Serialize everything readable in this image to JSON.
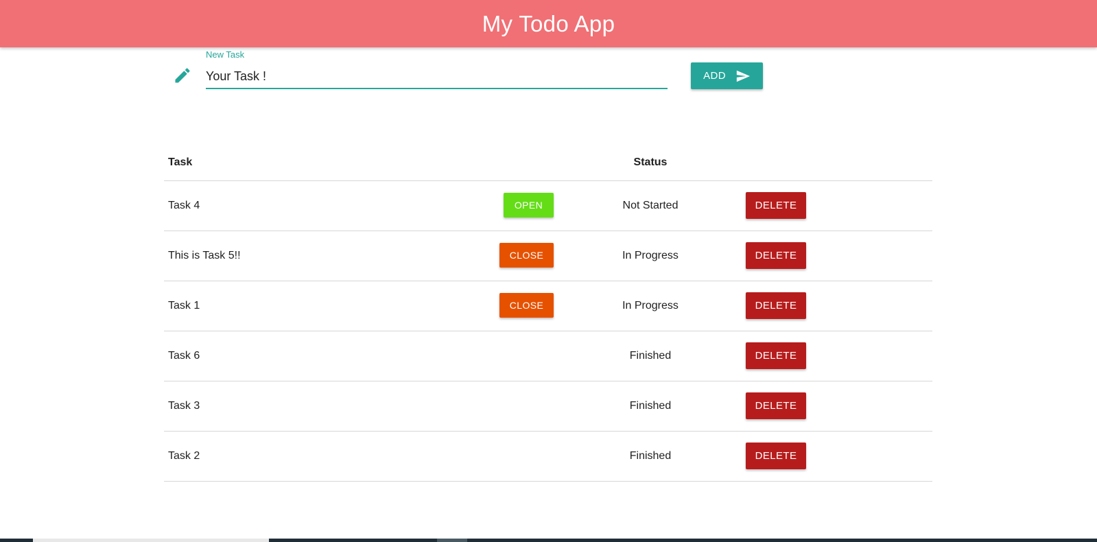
{
  "app": {
    "title": "My Todo App",
    "accent": "#26a69a",
    "bar_color": "#f07075"
  },
  "new_task": {
    "label": "New Task",
    "value": "Your Task !",
    "icon": "pencil-icon",
    "add_label": "ADD",
    "add_icon": "send-icon"
  },
  "table": {
    "headers": {
      "task": "Task",
      "status": "Status"
    },
    "rows": [
      {
        "task": "Task 4",
        "action": "OPEN",
        "status": "Not Started",
        "delete": "DELETE"
      },
      {
        "task": "This is Task 5!!",
        "action": "CLOSE",
        "status": "In Progress",
        "delete": "DELETE"
      },
      {
        "task": "Task 1",
        "action": "CLOSE",
        "status": "In Progress",
        "delete": "DELETE"
      },
      {
        "task": "Task 6",
        "action": "",
        "status": "Finished",
        "delete": "DELETE"
      },
      {
        "task": "Task 3",
        "action": "",
        "status": "Finished",
        "delete": "DELETE"
      },
      {
        "task": "Task 2",
        "action": "",
        "status": "Finished",
        "delete": "DELETE"
      }
    ]
  },
  "colors": {
    "open": "#64dd17",
    "close": "#e65100",
    "delete": "#b71c1c"
  }
}
